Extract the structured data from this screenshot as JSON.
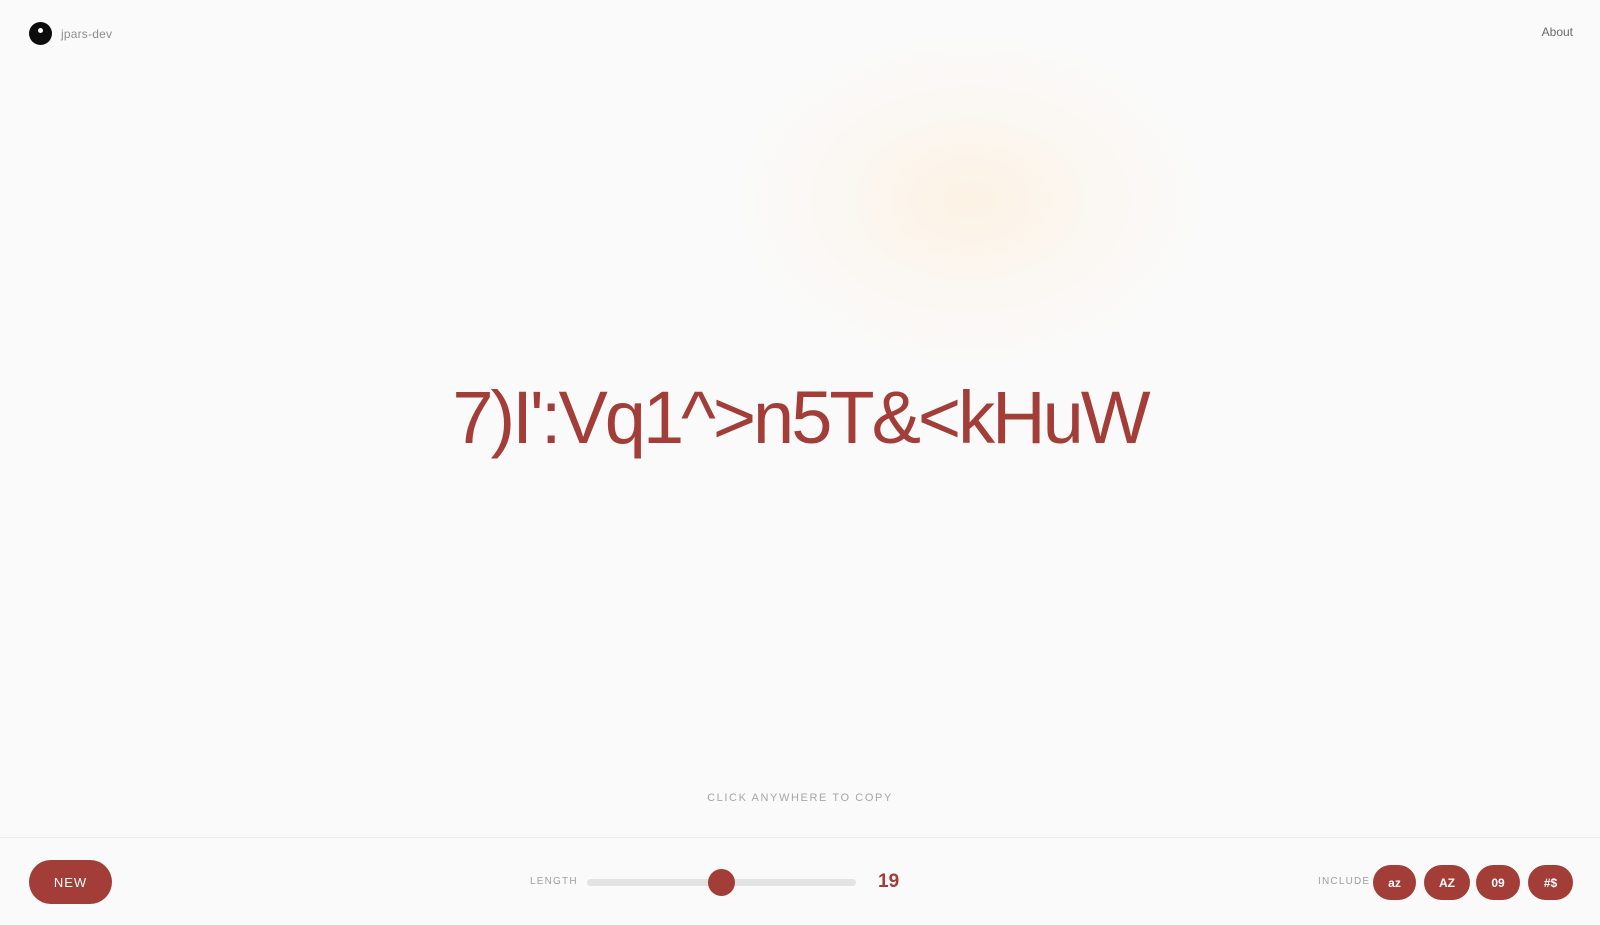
{
  "header": {
    "brand_name": "jpars-dev",
    "logo_icon": "logo-icon",
    "about_label": "About"
  },
  "main": {
    "password": "7)I':Vq1^>n5T&<kHuW",
    "copy_hint": "CLICK ANYWHERE TO COPY"
  },
  "controls": {
    "new_label": "NEW",
    "length_label": "LENGTH",
    "length_value": "19",
    "length_slider": {
      "min": 4,
      "max": 34,
      "value": 19
    },
    "include_label": "INCLUDE",
    "include_options": [
      {
        "label": "az",
        "active": true
      },
      {
        "label": "AZ",
        "active": true
      },
      {
        "label": "09",
        "active": true
      },
      {
        "label": "#$",
        "active": true
      }
    ]
  },
  "colors": {
    "accent": "#a23d37",
    "background": "#fafafa",
    "muted_text": "#a6a6a6",
    "track": "#e3e3e3"
  }
}
